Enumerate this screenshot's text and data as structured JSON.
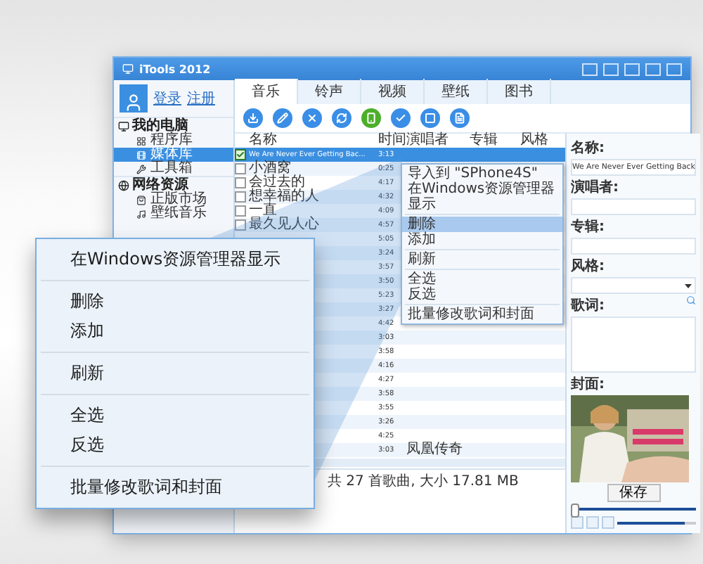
{
  "window": {
    "title": "iTools 2012"
  },
  "account": {
    "links": [
      "登录",
      "注册"
    ]
  },
  "sidebar": [
    {
      "label": "我的电脑",
      "children": [
        {
          "label": "程序库",
          "selected": false
        },
        {
          "label": "媒体库",
          "selected": true
        },
        {
          "label": "工具箱",
          "selected": false
        }
      ]
    },
    {
      "label": "网络资源",
      "children": [
        {
          "label": "正版市场",
          "selected": false
        },
        {
          "label": "壁纸音乐",
          "selected": false
        }
      ]
    }
  ],
  "tabs": [
    {
      "label": "音乐",
      "selected": true
    },
    {
      "label": "铃声",
      "selected": false
    },
    {
      "label": "视频",
      "selected": false
    },
    {
      "label": "壁纸",
      "selected": false
    },
    {
      "label": "图书",
      "selected": false
    }
  ],
  "toolbar": [
    {
      "kind": "import",
      "color": "#3a8ee6"
    },
    {
      "kind": "edit",
      "color": "#3a8ee6"
    },
    {
      "kind": "delete",
      "color": "#3a8ee6"
    },
    {
      "kind": "refresh",
      "color": "#3a8ee6"
    },
    {
      "kind": "phone",
      "color": "#4caf2a"
    },
    {
      "kind": "check",
      "color": "#3a8ee6"
    },
    {
      "kind": "stop",
      "color": "#3a8ee6"
    },
    {
      "kind": "file",
      "color": "#3a8ee6"
    }
  ],
  "table": {
    "columns": [
      "名称",
      "时间",
      "演唱者",
      "专辑",
      "风格"
    ],
    "rows": [
      {
        "checked": true,
        "selected": true,
        "name": "We Are Never Ever Getting Bac...",
        "time": "3:13"
      },
      {
        "checked": false,
        "selected": false,
        "name": "小酒窝",
        "time": "0:25"
      },
      {
        "checked": false,
        "selected": false,
        "name": "会过去的",
        "time": "4:17"
      },
      {
        "checked": false,
        "selected": false,
        "name": "想幸福的人",
        "time": "4:32"
      },
      {
        "checked": false,
        "selected": false,
        "name": "一直",
        "time": "4:09"
      },
      {
        "checked": false,
        "selected": false,
        "name": "最久见人心",
        "time": "4:57"
      },
      {
        "selected": false,
        "time": "5:05"
      },
      {
        "selected": false,
        "time": "3:24"
      },
      {
        "selected": false,
        "time": "3:57"
      },
      {
        "selected": false,
        "time": "3:50"
      },
      {
        "selected": false,
        "time": "5:23"
      },
      {
        "selected": false,
        "time": "3:27"
      },
      {
        "selected": false,
        "time": "4:42"
      },
      {
        "selected": false,
        "time": "3:03"
      },
      {
        "selected": false,
        "time": "3:58"
      },
      {
        "selected": false,
        "time": "4:16"
      },
      {
        "selected": false,
        "time": "4:27"
      },
      {
        "selected": false,
        "time": "3:58"
      },
      {
        "selected": false,
        "time": "3:55"
      },
      {
        "selected": false,
        "time": "3:26"
      },
      {
        "selected": false,
        "time": "4:25"
      },
      {
        "selected": false,
        "time": "3:03",
        "artist": "凤凰传奇"
      }
    ]
  },
  "context_menu": {
    "groups": [
      [
        {
          "label": "导入到 \"SPhone4S\"",
          "highlighted": false
        },
        {
          "label": "在Windows资源管理器显示",
          "highlighted": false
        }
      ],
      [
        {
          "label": "删除",
          "highlighted": true
        },
        {
          "label": "添加",
          "highlighted": false
        }
      ],
      [
        {
          "label": "刷新",
          "highlighted": false
        }
      ],
      [
        {
          "label": "全选",
          "highlighted": false
        },
        {
          "label": "反选",
          "highlighted": false
        }
      ],
      [
        {
          "label": "批量修改歌词和封面",
          "highlighted": false
        }
      ]
    ]
  },
  "status_bar": "共 27 首歌曲, 大小 17.81 MB",
  "details": {
    "fields": [
      {
        "kind": "text",
        "label": "名称:",
        "value": "We Are Never Ever Getting Back"
      },
      {
        "kind": "text",
        "label": "演唱者:"
      },
      {
        "kind": "text",
        "label": "专辑:"
      },
      {
        "kind": "select",
        "label": "风格:"
      }
    ],
    "lyrics_label": "歌词:",
    "cover_label": "封面:",
    "save_button": "保存"
  },
  "player": {
    "progress": {
      "level": 0.02
    },
    "volume": {
      "level": 0.85
    }
  },
  "callout_menu": {
    "groups": [
      [
        "在Windows资源管理器显示"
      ],
      [
        "删除",
        "添加"
      ],
      [
        "刷新"
      ],
      [
        "全选",
        "反选"
      ],
      [
        "批量修改歌词和封面"
      ]
    ]
  }
}
